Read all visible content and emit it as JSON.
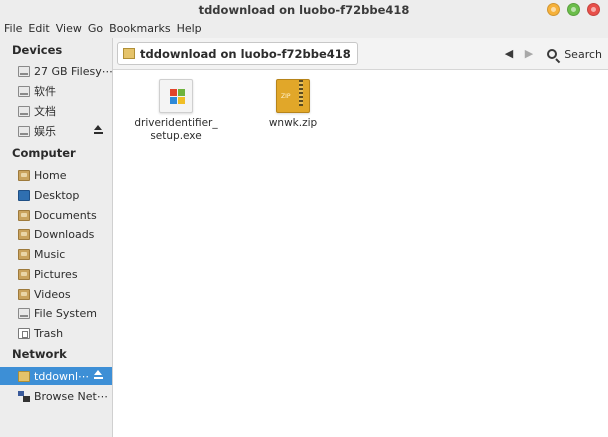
{
  "window": {
    "title": "tddownload on luobo-f72bbe418"
  },
  "menubar": {
    "items": [
      "File",
      "Edit",
      "View",
      "Go",
      "Bookmarks",
      "Help"
    ]
  },
  "sidebar": {
    "devices_heading": "Devices",
    "devices": [
      {
        "label": "27 GB Filesy⋯",
        "icon": "drive-icon"
      },
      {
        "label": "软件",
        "icon": "drive-icon"
      },
      {
        "label": "文档",
        "icon": "drive-icon"
      },
      {
        "label": "娱乐",
        "icon": "drive-icon"
      }
    ],
    "computer_heading": "Computer",
    "computer": [
      {
        "label": "Home",
        "icon": "home-folder-icon"
      },
      {
        "label": "Desktop",
        "icon": "desktop-icon"
      },
      {
        "label": "Documents",
        "icon": "documents-folder-icon"
      },
      {
        "label": "Downloads",
        "icon": "downloads-folder-icon"
      },
      {
        "label": "Music",
        "icon": "music-folder-icon"
      },
      {
        "label": "Pictures",
        "icon": "pictures-folder-icon"
      },
      {
        "label": "Videos",
        "icon": "videos-folder-icon"
      },
      {
        "label": "File System",
        "icon": "drive-icon"
      },
      {
        "label": "Trash",
        "icon": "trash-icon"
      }
    ],
    "network_heading": "Network",
    "network": [
      {
        "label": "tddownl⋯",
        "icon": "network-share-icon",
        "active": true
      },
      {
        "label": "Browse Net⋯",
        "icon": "network-icon"
      }
    ]
  },
  "toolbar": {
    "location": "tddownload on luobo-f72bbe418",
    "search_label": "Search"
  },
  "files": [
    {
      "name": "driveridentifier_\nsetup.exe",
      "icon": "windows-exe-icon"
    },
    {
      "name": "wnwk.zip",
      "icon": "zip-archive-icon"
    }
  ],
  "colors": {
    "selection": "#3d8fd6",
    "chrome": "#ededed",
    "close_button": "#e8504a",
    "maximize_button": "#6bbd4a",
    "minimize_button": "#f6b13a"
  }
}
